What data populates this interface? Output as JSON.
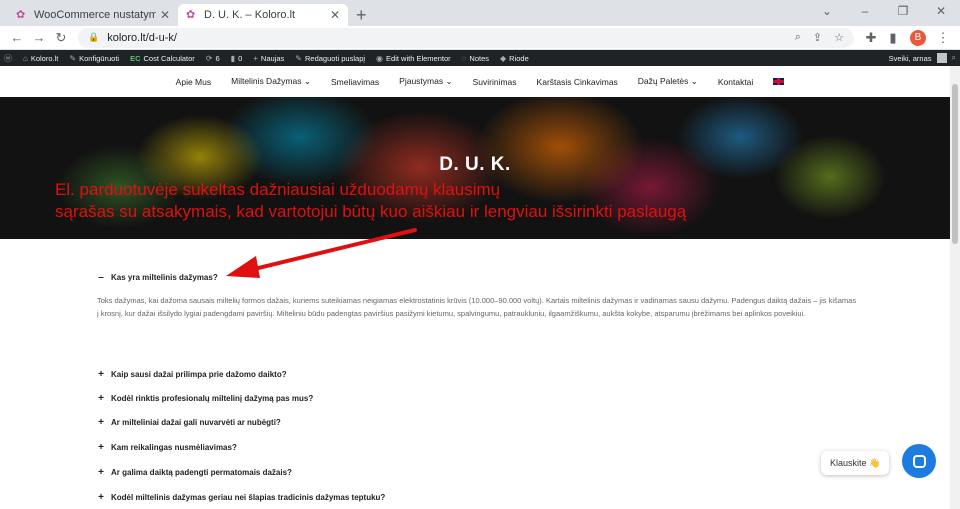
{
  "browser": {
    "tabs": [
      {
        "title": "WooCommerce nustatymai ‹ Kolo",
        "active": false
      },
      {
        "title": "D. U. K. – Koloro.lt",
        "active": true
      }
    ],
    "url": "koloro.lt/d-u-k/",
    "profile_initial": "B"
  },
  "wpbar": {
    "site": "Koloro.lt",
    "customize": "Konfigūruoti",
    "cost_calculator": "Cost Calculator",
    "updates": "6",
    "comments": "0",
    "new": "Naujas",
    "edit": "Redaguoti puslapį",
    "elementor": "Edit with Elementor",
    "notes": "Notes",
    "riode": "Riode",
    "greeting": "Sveiki, arnas"
  },
  "nav": {
    "items": [
      "Apie Mus",
      "Miltelinis Dažymas",
      "Smeliavimas",
      "Pjaustymas",
      "Suvirinimas",
      "Karštasis Cinkavimas",
      "Dažų Paletės",
      "Kontaktai"
    ]
  },
  "hero": {
    "title": "D. U. K.",
    "annotation_line1": "El. parduotuvėje sukeltas dažniausiai užduodamų klausimų",
    "annotation_line2": "sąrašas su atsakymais, kad vartotojui būtų kuo aiškiau ir lengviau išsirinkti paslaugą"
  },
  "faq": {
    "open_question": "Kas yra miltelinis dažymas?",
    "answer": "Toks dažymas, kai dažoma sausais miltelių formos dažais, kuriems suteikiamas neigiamas elektrostatinis krūvis (10.000–90.000 voltų). Kartais miltelinis dažymas ir vadinamas sausu dažymu. Padengus daiktą dažais – jis kišamas į krosnį, kur dažai išsilydo lygiai padengdami paviršių. Milteliniu būdu padengtas paviršius pasižymi kietumu, spalvingumu, patraukluniu, ilgaamžiškumu, aukšta kokybe, atsparumu įbrėžimams bei aplinkos poveikiui.",
    "questions": [
      "Kaip sausi dažai prilimpa prie dažomo daikto?",
      "Kodėl rinktis profesionalų miltelinį dažymą pas mus?",
      "Ar milteliniai dažai gali nuvarvėti ar nubėgti?",
      "Kam reikalingas nusmėliavimas?",
      "Ar galima daiktą padengti permatomais dažais?",
      "Kodėl miltelinis dažymas geriau nei šlapias tradicinis dažymas teptuku?"
    ]
  },
  "chat": {
    "label": "Klauskite 👋"
  },
  "colors": {
    "annotation": "#e01010",
    "chat_button": "#1c7ce0",
    "wpbar": "#1d2327"
  }
}
